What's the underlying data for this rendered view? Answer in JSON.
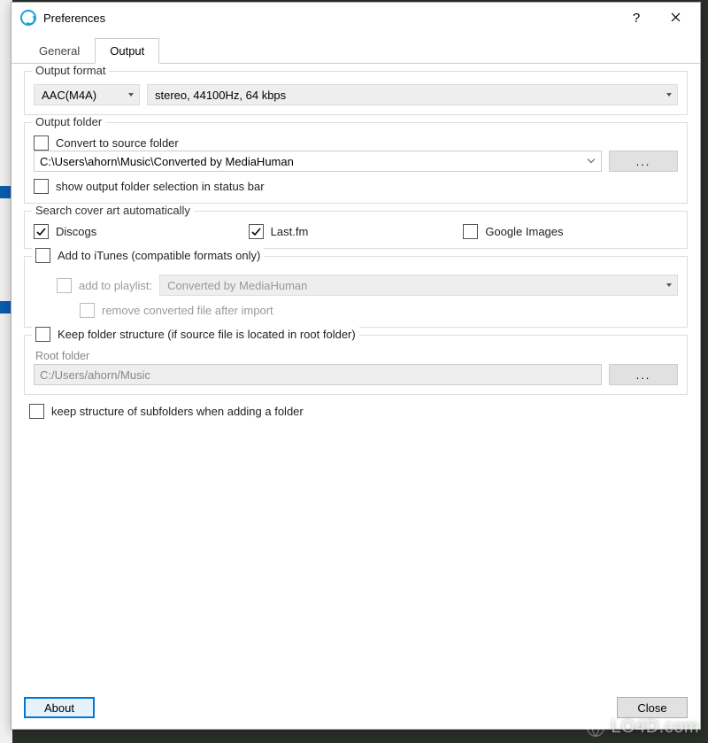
{
  "window": {
    "title": "Preferences",
    "help_tooltip": "?",
    "close_tooltip": "Close"
  },
  "tabs": {
    "general": "General",
    "output": "Output"
  },
  "outputFormat": {
    "legend": "Output format",
    "codec": "AAC(M4A)",
    "quality": "stereo, 44100Hz, 64 kbps"
  },
  "outputFolder": {
    "legend": "Output folder",
    "convertToSource": "Convert to source folder",
    "path": "C:\\Users\\ahorn\\Music\\Converted by MediaHuman",
    "browse": "...",
    "showInStatusBar": "show output folder selection in status bar"
  },
  "coverArt": {
    "legend": "Search cover art automatically",
    "discogs": "Discogs",
    "lastfm": "Last.fm",
    "google": "Google Images"
  },
  "itunes": {
    "addToItunes": "Add to iTunes (compatible formats only)",
    "addToPlaylist": "add to playlist:",
    "playlistName": "Converted by MediaHuman",
    "removeAfter": "remove converted file after import"
  },
  "keepFolder": {
    "keepStructure": "Keep folder structure (if source file is located in root folder)",
    "rootFolderLabel": "Root folder",
    "rootFolder": "C:/Users/ahorn/Music",
    "browse": "..."
  },
  "keepSubfolders": "keep structure of subfolders when adding a folder",
  "buttons": {
    "about": "About",
    "close": "Close"
  },
  "watermark": "LO4D.com"
}
